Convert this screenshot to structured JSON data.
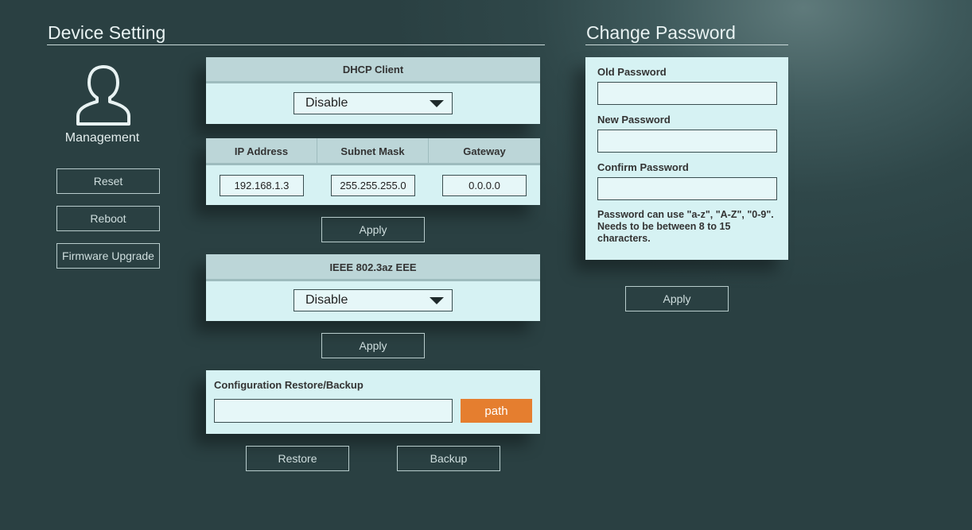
{
  "device_setting": {
    "title": "Device Setting",
    "management_label": "Management",
    "buttons": {
      "reset": "Reset",
      "reboot": "Reboot",
      "firmware_upgrade": "Firmware Upgrade"
    }
  },
  "dhcp": {
    "header": "DHCP Client",
    "value": "Disable"
  },
  "network": {
    "headers": [
      "IP Address",
      "Subnet Mask",
      "Gateway"
    ],
    "values": [
      "192.168.1.3",
      "255.255.255.0",
      "0.0.0.0"
    ],
    "apply_label": "Apply"
  },
  "eee": {
    "header": "IEEE 802.3az EEE",
    "value": "Disable",
    "apply_label": "Apply"
  },
  "config": {
    "label": "Configuration Restore/Backup",
    "path_value": "",
    "path_button": "path",
    "restore_label": "Restore",
    "backup_label": "Backup"
  },
  "change_password": {
    "title": "Change Password",
    "old_label": "Old Password",
    "new_label": "New Password",
    "confirm_label": "Confirm Password",
    "hint": "Password can use \"a-z\", \"A-Z\", \"0-9\". Needs to be between 8 to 15 characters.",
    "apply_label": "Apply"
  },
  "colors": {
    "accent_orange": "#e57e2f",
    "panel_bg": "#d6f2f3",
    "panel_header": "#bcd6d8"
  }
}
